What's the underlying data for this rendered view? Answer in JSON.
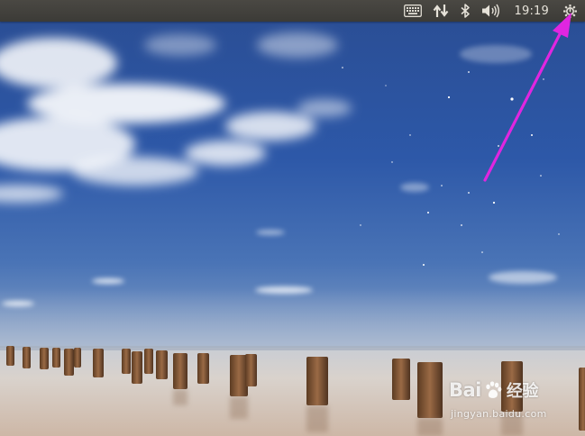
{
  "desktop": {
    "wallpaper_name": "night-sea-groynes-wallpaper"
  },
  "top_panel": {
    "indicators": [
      {
        "name": "keyboard-layout",
        "icon": "keyboard-icon"
      },
      {
        "name": "network",
        "icon": "network-updown-icon"
      },
      {
        "name": "bluetooth",
        "icon": "bluetooth-icon"
      },
      {
        "name": "sound",
        "icon": "volume-icon"
      }
    ],
    "clock": "19:19",
    "session_icon": "gear-icon"
  },
  "annotation": {
    "arrow_color": "#e026e0"
  },
  "watermark": {
    "brand_left": "Bai",
    "brand_right": "经验",
    "url": "jingyan.baidu.com"
  }
}
